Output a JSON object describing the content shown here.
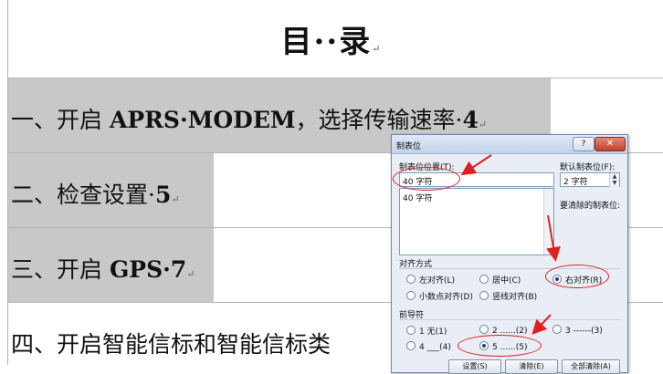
{
  "document": {
    "title": "目··录",
    "toc": [
      {
        "prefix": "一、开启 ",
        "bold": "APRS·MODEM",
        "suffix": "，选择传输速率·",
        "page": "4"
      },
      {
        "prefix": "二、检查设置·",
        "bold": "",
        "suffix": "",
        "page": "5"
      },
      {
        "prefix": "三、开启 ",
        "bold": "GPS·",
        "suffix": "",
        "page": "7"
      },
      {
        "prefix": "四、开启智能信标和智能信标类",
        "bold": "",
        "suffix": "",
        "page": ""
      }
    ],
    "para_mark": "↵"
  },
  "dialog": {
    "title": "制表位",
    "help_label": "?",
    "close_label": "✕",
    "tab_position_label": "制表位位置(T):",
    "tab_position_value": "40 字符",
    "tab_list": [
      "40 字符"
    ],
    "default_tab_label": "默认制表位(F):",
    "default_tab_value": "2 字符",
    "clear_label": "要清除的制表位:",
    "alignment_label": "对齐方式",
    "alignment_options": [
      "左对齐(L)",
      "居中(C)",
      "右对齐(R)",
      "小数点对齐(D)",
      "竖线对齐(B)"
    ],
    "alignment_selected": "右对齐(R)",
    "leader_label": "前导符",
    "leader_options": [
      "1 无(1)",
      "2 ......(2)",
      "3 ------(3)",
      "4 ___(4)",
      "5 ......(5)"
    ],
    "leader_selected": "5 ......(5)",
    "buttons": [
      "设置(S)",
      "清除(E)",
      "全部清除(A)"
    ]
  },
  "colors": {
    "annotation": "#e02020",
    "highlight": "#c8c8c8"
  }
}
